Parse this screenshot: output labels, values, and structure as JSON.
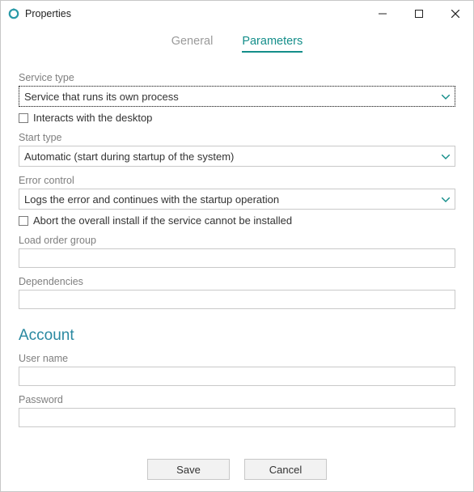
{
  "window": {
    "title": "Properties"
  },
  "tabs": {
    "general": "General",
    "parameters": "Parameters",
    "active": "parameters"
  },
  "labels": {
    "service_type": "Service type",
    "interacts_desktop": "Interacts with the desktop",
    "start_type": "Start type",
    "error_control": "Error control",
    "abort_install": "Abort the overall install if the service cannot be installed",
    "load_order_group": "Load order group",
    "dependencies": "Dependencies",
    "account_heading": "Account",
    "user_name": "User name",
    "password": "Password"
  },
  "values": {
    "service_type": "Service that runs its own process",
    "start_type": "Automatic (start during startup of the system)",
    "error_control": "Logs the error and continues with the startup operation",
    "interacts_desktop_checked": false,
    "abort_install_checked": false,
    "load_order_group": "",
    "dependencies": "",
    "user_name": "",
    "password": ""
  },
  "buttons": {
    "save": "Save",
    "cancel": "Cancel"
  },
  "colors": {
    "accent": "#148e8a",
    "heading": "#2a89a1"
  }
}
